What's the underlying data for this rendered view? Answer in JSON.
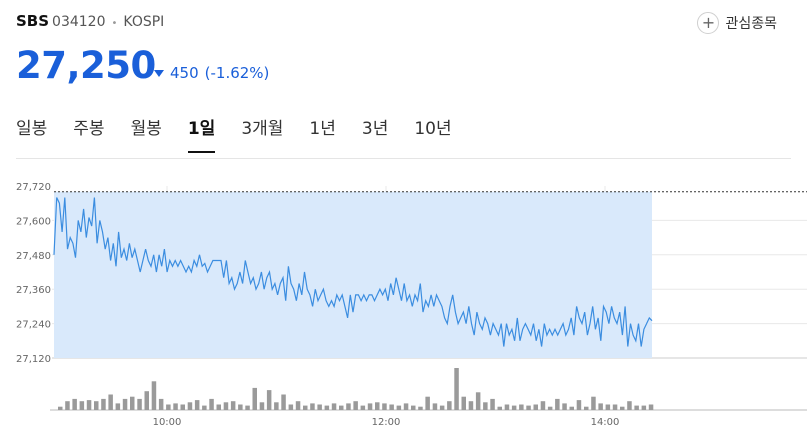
{
  "header": {
    "name": "SBS",
    "code": "034120",
    "separator": "•",
    "market": "KOSPI",
    "favorite_label": "관심종목",
    "favorite_icon": "plus-icon"
  },
  "price": {
    "current": "27,250",
    "change": "450",
    "change_rate": "(-1.62%)",
    "direction": "down",
    "color": "#1a5fd9"
  },
  "tabs": [
    {
      "label": "일봉",
      "active": false
    },
    {
      "label": "주봉",
      "active": false
    },
    {
      "label": "월봉",
      "active": false
    },
    {
      "label": "1일",
      "active": true
    },
    {
      "label": "3개월",
      "active": false
    },
    {
      "label": "1년",
      "active": false
    },
    {
      "label": "3년",
      "active": false
    },
    {
      "label": "10년",
      "active": false
    }
  ],
  "chart_data": {
    "type": "line",
    "line_color": "#3b8de0",
    "fill_color": "#d9e9fb",
    "y_ticks": [
      "27,720",
      "27,600",
      "27,480",
      "27,360",
      "27,240",
      "27,120"
    ],
    "ylim": [
      27120,
      27720
    ],
    "x_ticks": [
      "10:00",
      "12:00",
      "14:00"
    ],
    "reference_line": 27700,
    "price_series": [
      27480,
      27680,
      27660,
      27560,
      27680,
      27500,
      27540,
      27520,
      27470,
      27600,
      27560,
      27640,
      27540,
      27610,
      27580,
      27680,
      27520,
      27600,
      27560,
      27500,
      27540,
      27460,
      27520,
      27440,
      27560,
      27470,
      27500,
      27460,
      27520,
      27470,
      27500,
      27460,
      27420,
      27460,
      27500,
      27460,
      27440,
      27480,
      27420,
      27480,
      27440,
      27500,
      27420,
      27460,
      27440,
      27460,
      27440,
      27460,
      27440,
      27420,
      27440,
      27420,
      27460,
      27440,
      27480,
      27440,
      27450,
      27420,
      27440,
      27460,
      27460,
      27460,
      27460,
      27400,
      27460,
      27380,
      27400,
      27360,
      27380,
      27420,
      27380,
      27460,
      27420,
      27380,
      27400,
      27360,
      27380,
      27420,
      27360,
      27400,
      27420,
      27360,
      27380,
      27340,
      27380,
      27400,
      27320,
      27440,
      27380,
      27360,
      27320,
      27380,
      27340,
      27420,
      27360,
      27340,
      27300,
      27360,
      27320,
      27340,
      27360,
      27320,
      27300,
      27320,
      27300,
      27340,
      27320,
      27340,
      27300,
      27260,
      27340,
      27280,
      27340,
      27340,
      27320,
      27340,
      27320,
      27340,
      27340,
      27320,
      27340,
      27360,
      27340,
      27360,
      27320,
      27380,
      27340,
      27400,
      27360,
      27320,
      27380,
      27320,
      27340,
      27300,
      27340,
      27320,
      27380,
      27280,
      27320,
      27300,
      27340,
      27300,
      27340,
      27320,
      27300,
      27260,
      27240,
      27300,
      27340,
      27280,
      27240,
      27260,
      27280,
      27240,
      27300,
      27240,
      27200,
      27280,
      27240,
      27220,
      27260,
      27240,
      27200,
      27240,
      27220,
      27200,
      27240,
      27160,
      27240,
      27200,
      27220,
      27180,
      27260,
      27180,
      27220,
      27240,
      27220,
      27200,
      27240,
      27180,
      27220,
      27160,
      27240,
      27200,
      27220,
      27200,
      27220,
      27200,
      27220,
      27240,
      27200,
      27220,
      27260,
      27200,
      27300,
      27260,
      27240,
      27280,
      27200,
      27240,
      27300,
      27220,
      27260,
      27180,
      27300,
      27280,
      27240,
      27300,
      27260,
      27240,
      27280,
      27200,
      27300,
      27160,
      27240,
      27200,
      27180,
      27240,
      27160,
      27220,
      27240,
      27260,
      27250
    ],
    "volume_series": [
      3,
      8,
      10,
      8,
      9,
      8,
      10,
      14,
      6,
      10,
      12,
      10,
      17,
      26,
      10,
      5,
      6,
      5,
      7,
      9,
      4,
      10,
      5,
      7,
      8,
      5,
      4,
      20,
      7,
      18,
      7,
      14,
      5,
      8,
      4,
      6,
      5,
      4,
      6,
      4,
      6,
      8,
      4,
      6,
      7,
      6,
      5,
      4,
      6,
      4,
      3,
      12,
      6,
      4,
      8,
      38,
      12,
      8,
      16,
      7,
      10,
      3,
      5,
      4,
      5,
      4,
      5,
      8,
      3,
      10,
      6,
      3,
      9,
      3,
      12,
      6,
      5,
      5,
      3,
      8,
      4,
      4,
      5
    ]
  }
}
